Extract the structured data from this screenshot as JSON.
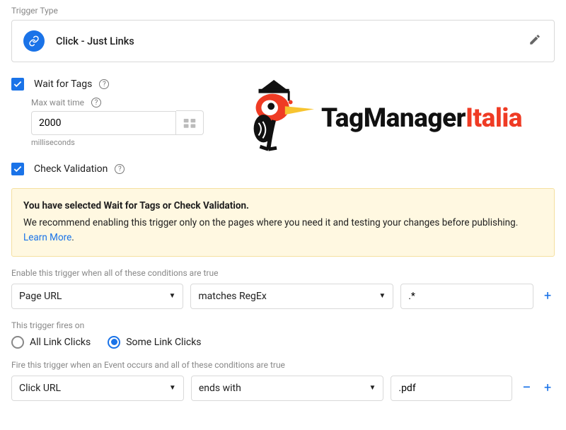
{
  "triggerType": {
    "sectionLabel": "Trigger Type",
    "title": "Click - Just Links"
  },
  "waitForTags": {
    "label": "Wait for Tags",
    "maxWaitLabel": "Max wait time",
    "maxWaitValue": "2000",
    "unit": "milliseconds"
  },
  "checkValidation": {
    "label": "Check Validation"
  },
  "warning": {
    "title": "You have selected Wait for Tags or Check Validation.",
    "body": "We recommend enabling this trigger only on the pages where you need it and testing your changes before publishing.",
    "link": "Learn More"
  },
  "enableCond": {
    "label": "Enable this trigger when all of these conditions are true",
    "variable": "Page URL",
    "operator": "matches RegEx",
    "value": ".*"
  },
  "firesOn": {
    "label": "This trigger fires on",
    "optionAll": "All Link Clicks",
    "optionSome": "Some Link Clicks"
  },
  "fireCond": {
    "label": "Fire this trigger when an Event occurs and all of these conditions are true",
    "variable": "Click URL",
    "operator": "ends with",
    "value": ".pdf"
  },
  "brand": {
    "part1": "TagManager",
    "part2": "Italia"
  }
}
